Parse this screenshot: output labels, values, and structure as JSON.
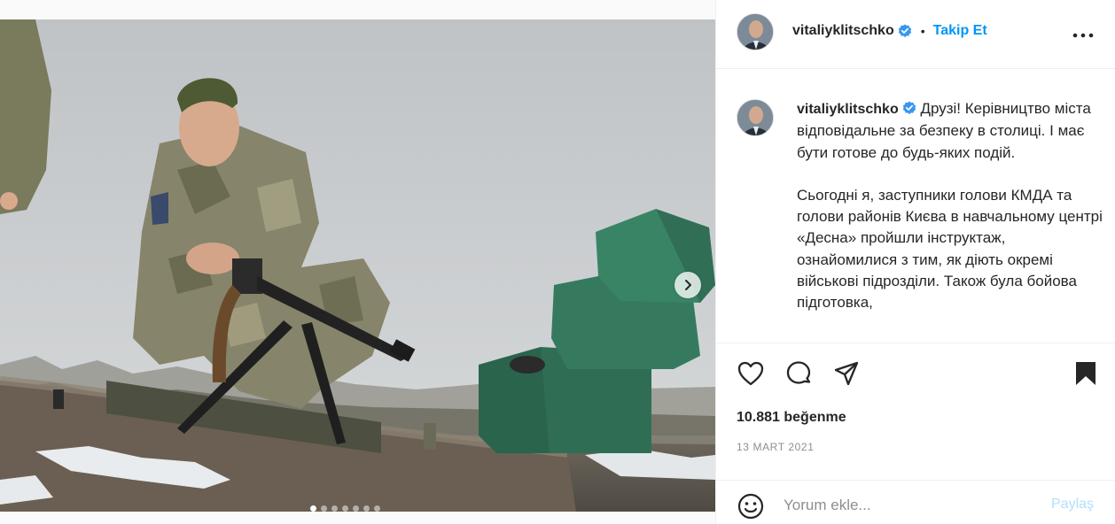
{
  "post": {
    "username": "vitaliyklitschko",
    "follow_label": "Takip Et",
    "separator": "•",
    "caption": {
      "username": "vitaliyklitschko",
      "paragraph1": "Друзі! Керівництво міста відповідальне за безпеку в столиці. І має бути готове до будь-яких подій.",
      "paragraph2": "Сьогодні я, заступники голови КМДА та голови районів Києва в навчальному центрі «Десна» пройшли інструктаж, ознайомилися з тим, як діють окремі військові підрозділи. Також була бойова підготовка,"
    },
    "likes": "10.881 beğenme",
    "date": "13 MART 2021",
    "carousel": {
      "total_slides": 7,
      "active_index": 0
    }
  },
  "comment": {
    "placeholder": "Yorum ekle...",
    "share_label": "Paylaş"
  },
  "icons": {
    "verified": "verified-badge-icon",
    "more": "more-options-icon",
    "like": "heart-icon",
    "comment": "comment-icon",
    "share": "share-icon",
    "save": "bookmark-icon",
    "emoji": "emoji-icon",
    "next": "chevron-right-icon"
  },
  "colors": {
    "accent": "#0095f6",
    "verified": "#3897f0",
    "share_disabled": "#b2dffc",
    "muted": "#8e8e8e"
  }
}
